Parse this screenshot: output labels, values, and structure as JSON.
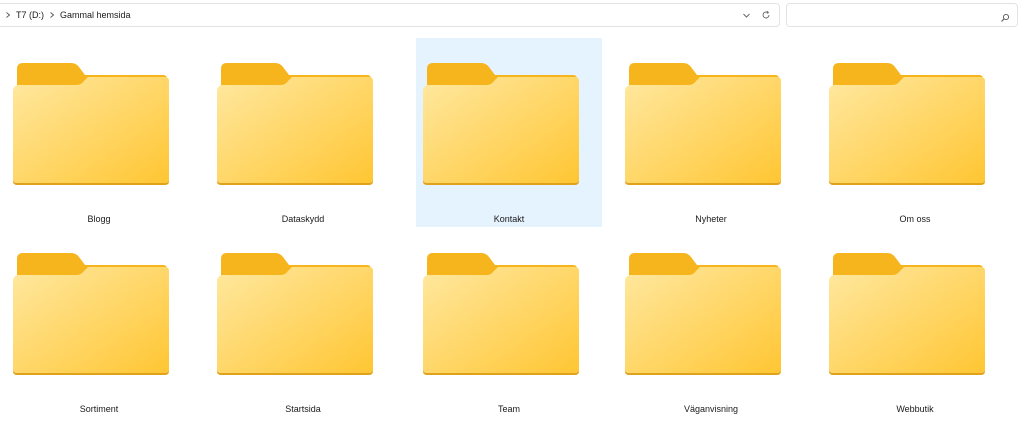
{
  "breadcrumb": {
    "items": [
      "T7 (D:)",
      "Gammal hemsida"
    ]
  },
  "address_bar": {
    "dropdown_icon": "chevron-down-icon",
    "refresh_icon": "refresh-icon"
  },
  "search": {
    "value": "",
    "placeholder": "",
    "icon": "search-icon"
  },
  "folders": [
    {
      "label": "Blogg",
      "selected": false
    },
    {
      "label": "Dataskydd",
      "selected": false
    },
    {
      "label": "Kontakt",
      "selected": true
    },
    {
      "label": "Nyheter",
      "selected": false
    },
    {
      "label": "Om oss",
      "selected": false
    },
    {
      "label": "Sortiment",
      "selected": false
    },
    {
      "label": "Startsida",
      "selected": false
    },
    {
      "label": "Team",
      "selected": false
    },
    {
      "label": "Väganvisning",
      "selected": false
    },
    {
      "label": "Webbutik",
      "selected": false
    }
  ],
  "colors": {
    "selection": "#e5f3ff",
    "folder_back": "#f6b51c",
    "folder_front_light": "#ffe9a3",
    "folder_front_dark": "#ffc83d"
  }
}
